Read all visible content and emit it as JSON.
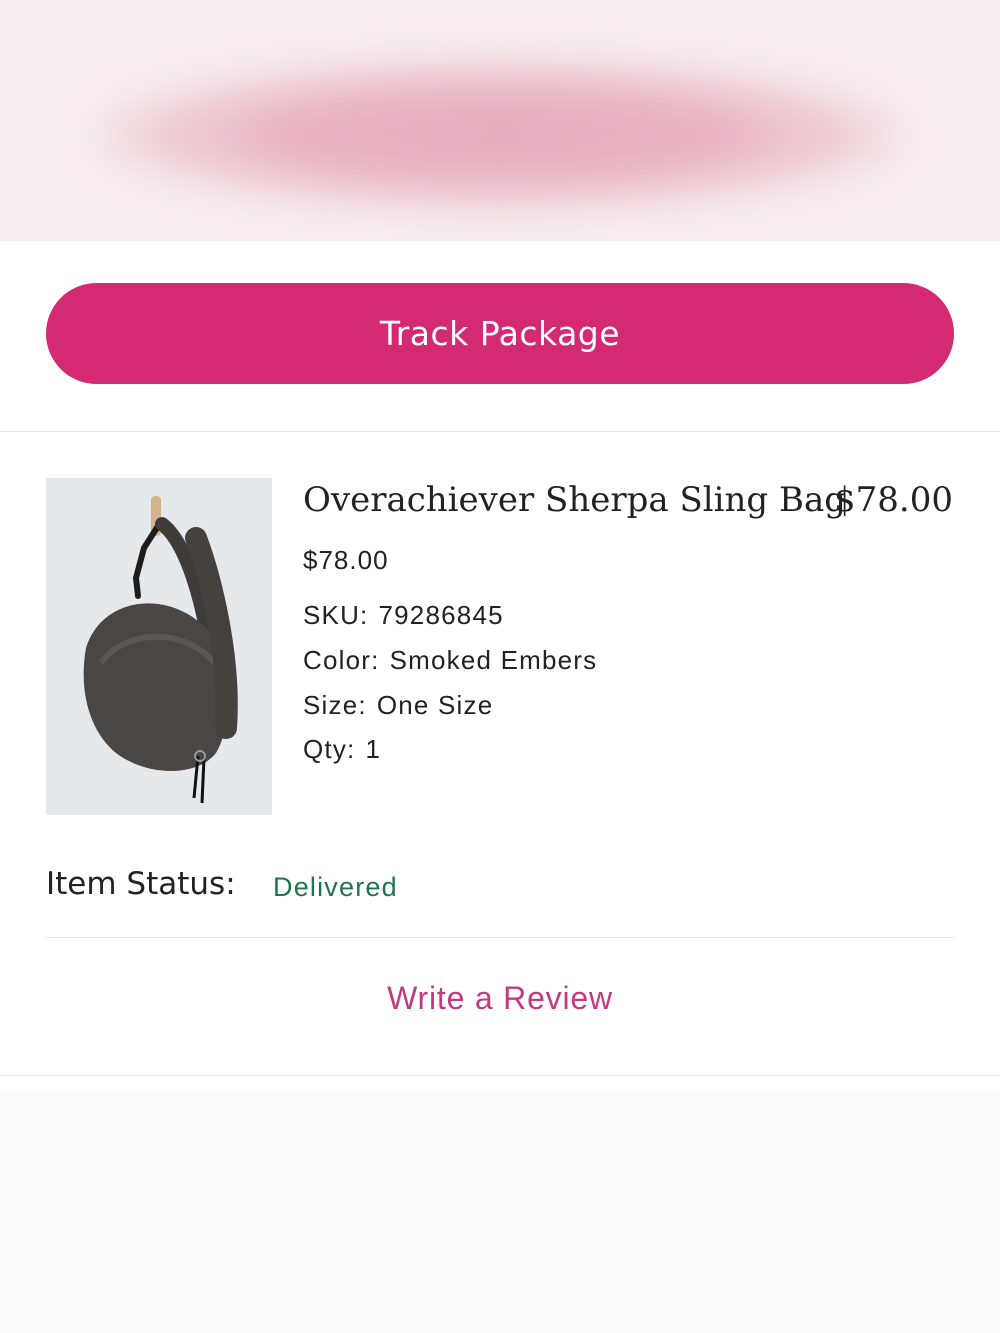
{
  "banner": {
    "state": "blurred"
  },
  "order": {
    "track_label": "Track Package"
  },
  "item": {
    "name": "Overachiever Sherpa Sling Bag",
    "total": "$78.00",
    "price": "$78.00",
    "sku_label": "SKU:",
    "sku": "79286845",
    "color_label": "Color:",
    "color": "Smoked Embers",
    "size_label": "Size:",
    "size": "One Size",
    "qty_label": "Qty:",
    "qty": "1",
    "status_label": "Item Status:",
    "status": "Delivered",
    "review_label": "Write a Review"
  },
  "colors": {
    "brand": "#d42a74",
    "status": "#21734d",
    "link": "#c43a7e"
  }
}
